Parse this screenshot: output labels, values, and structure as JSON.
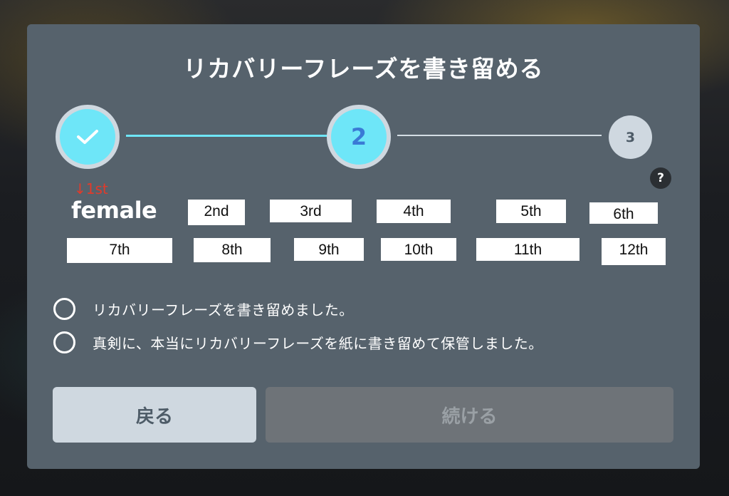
{
  "dialog": {
    "title": "リカバリーフレーズを書き留める",
    "help_icon": "?"
  },
  "stepper": {
    "step1_icon": "checkmark-icon",
    "step2_label": "2",
    "step3_label": "3"
  },
  "phrase": {
    "first_marker": "↓1st",
    "first_word": "female",
    "words": [
      "2nd",
      "3rd",
      "4th",
      "5th",
      "6th",
      "7th",
      "8th",
      "9th",
      "10th",
      "11th",
      "12th"
    ]
  },
  "confirmations": [
    "リカバリーフレーズを書き留めました。",
    "真剣に、本当にリカバリーフレーズを紙に書き留めて保管しました。"
  ],
  "buttons": {
    "back": "戻る",
    "continue": "続ける"
  },
  "colors": {
    "modal_bg": "#56626c",
    "accent_cyan": "#6ee6f8",
    "step_number_blue": "#3a7bd5",
    "first_marker_red": "#e23a2a"
  }
}
